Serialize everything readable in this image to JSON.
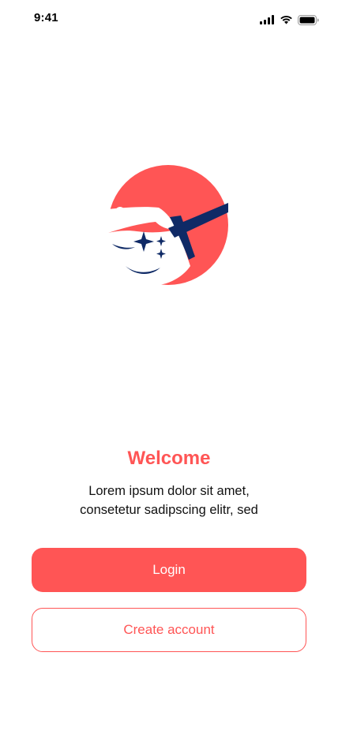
{
  "status_bar": {
    "time": "9:41",
    "icons": [
      "cellular-signal-icon",
      "wifi-icon",
      "battery-icon"
    ]
  },
  "logo": {
    "icon": "cleaning-squeegee-sparkle-logo",
    "colors": {
      "primary": "#ff5555",
      "accent": "#0f2a66"
    }
  },
  "welcome": {
    "title": "Welcome",
    "description_line1": "Lorem ipsum dolor sit amet,",
    "description_line2": "consetetur sadipscing elitr, sed"
  },
  "actions": {
    "login_label": "Login",
    "create_account_label": "Create account"
  },
  "theme": {
    "accent": "#ff5555",
    "text": "#111111",
    "background": "#ffffff"
  }
}
